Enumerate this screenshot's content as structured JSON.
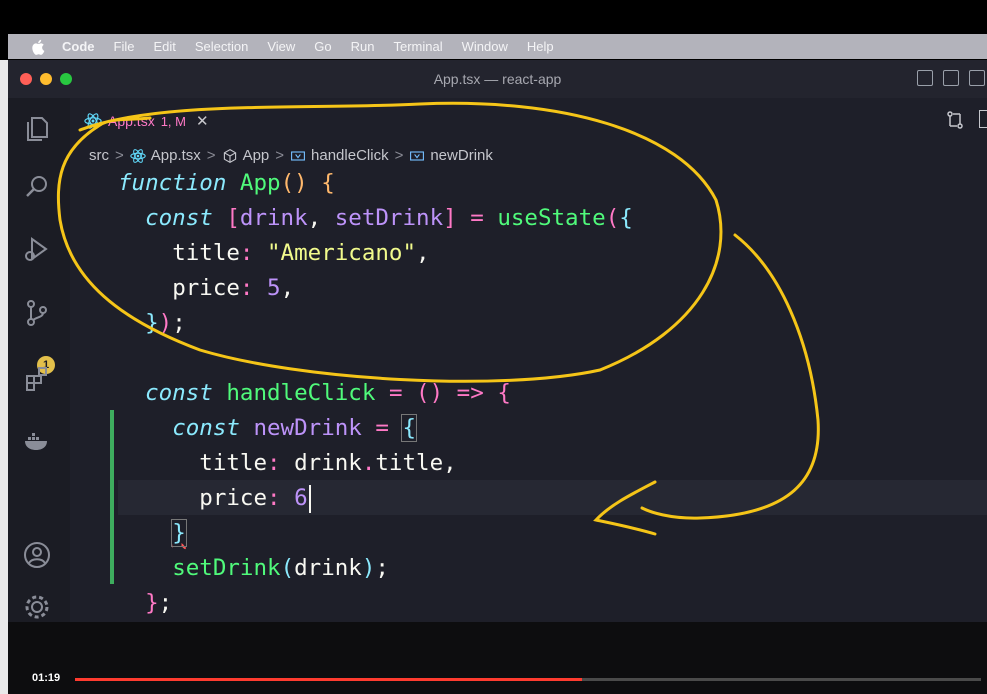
{
  "menubar": {
    "items": [
      "Code",
      "File",
      "Edit",
      "Selection",
      "View",
      "Go",
      "Run",
      "Terminal",
      "Window",
      "Help"
    ]
  },
  "window": {
    "title": "App.tsx — react-app"
  },
  "activity": {
    "scm_badge": "1"
  },
  "tab": {
    "filename": "App.tsx",
    "status": "1, M",
    "close": "✕"
  },
  "breadcrumbs": {
    "folder": "src",
    "file": "App.tsx",
    "component": "App",
    "function": "handleClick",
    "variable": "newDrink"
  },
  "code": {
    "l1_kw": "function",
    "l1_name": "App",
    "l2_kw": "const",
    "l2_a": "drink",
    "l2_b": "setDrink",
    "l2_fn": "useState",
    "l3_key": "title",
    "l3_val": "\"Americano\"",
    "l4_key": "price",
    "l4_val": "5",
    "l6_kw": "const",
    "l6_name": "handleClick",
    "l7_kw": "const",
    "l7_name": "newDrink",
    "l8_key": "title",
    "l8_val": "drink",
    "l8_prop": "title",
    "l9_key": "price",
    "l9_val": "6",
    "l11_fn": "setDrink",
    "l11_arg": "drink"
  },
  "player": {
    "time": "01:19",
    "progress": 0.56
  },
  "colors": {
    "annotation": "#f5c518",
    "progress": "#ff3b2f",
    "git_added": "#50fa7b"
  }
}
